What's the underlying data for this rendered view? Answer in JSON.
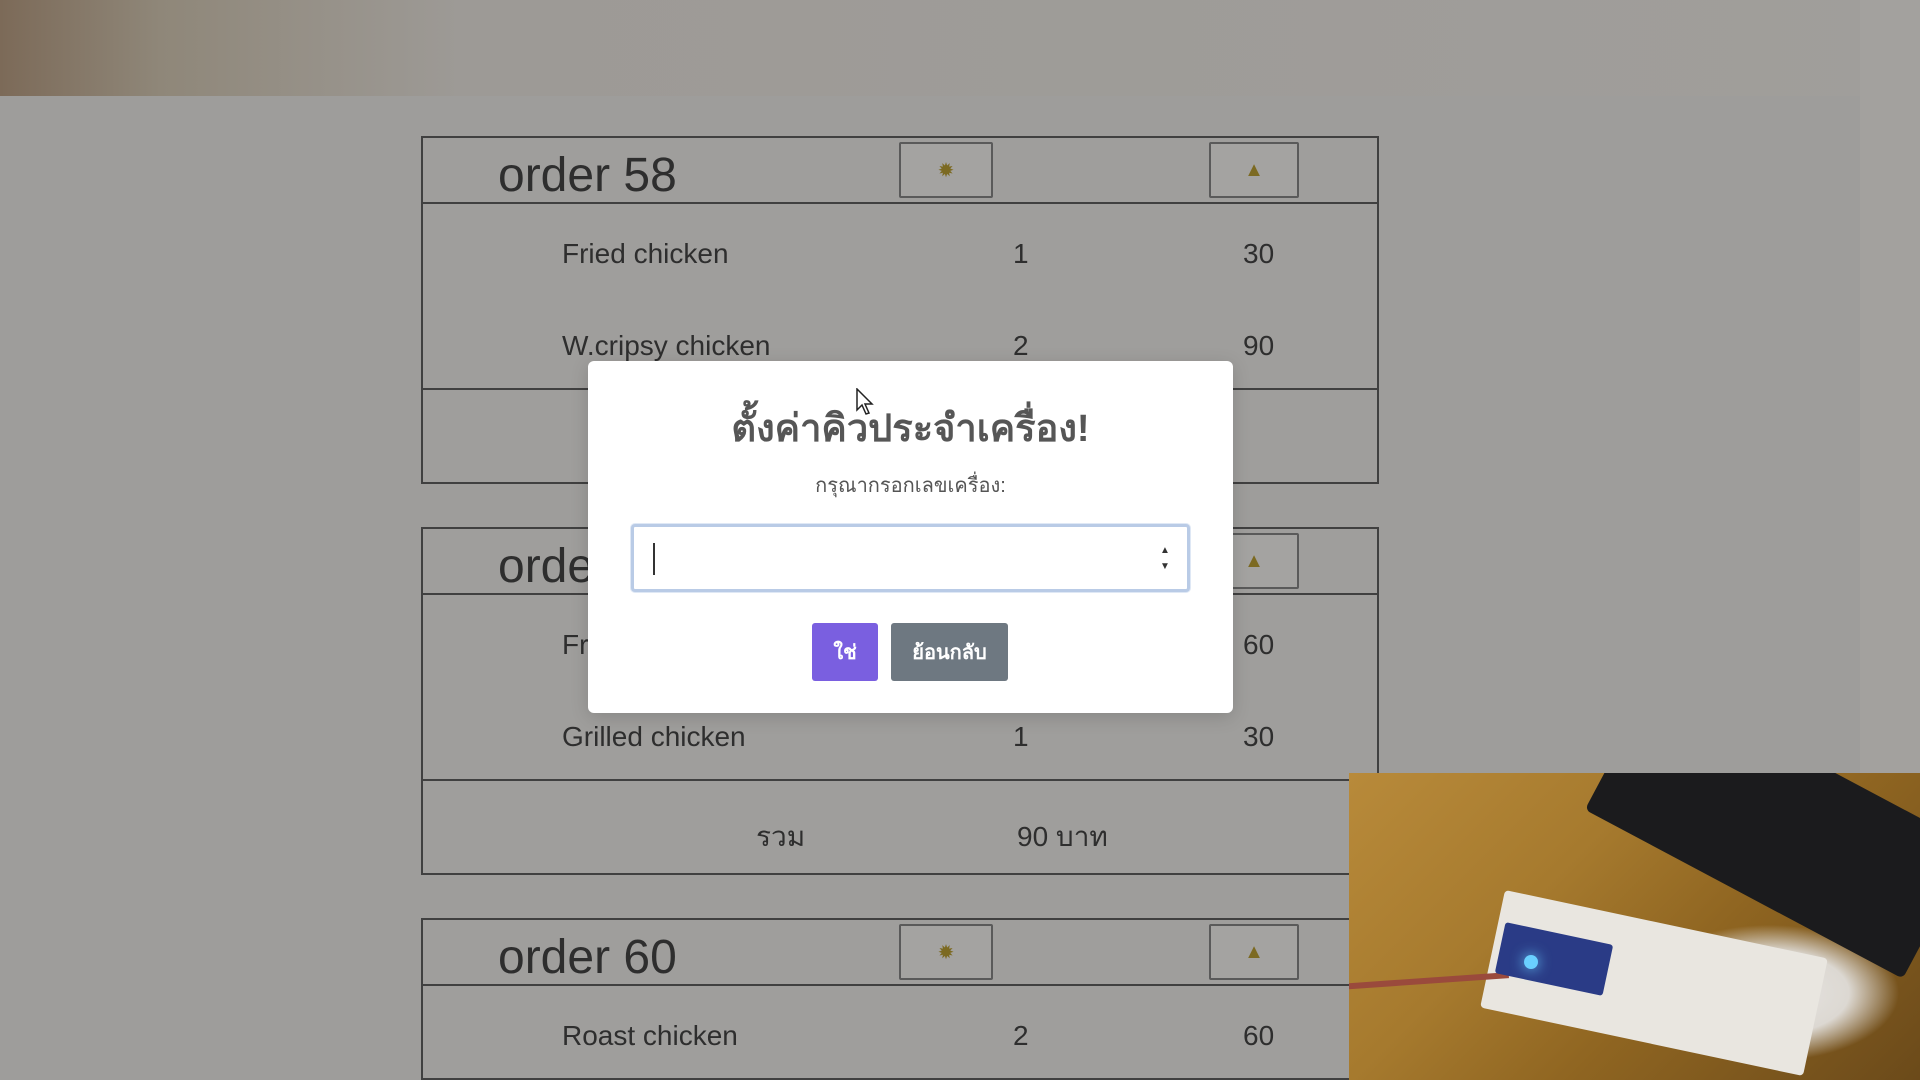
{
  "orders": [
    {
      "title": "order 58",
      "items": [
        {
          "name": "Fried chicken",
          "qty": "1",
          "price": "30"
        },
        {
          "name": "W.cripsy chicken",
          "qty": "2",
          "price": "90"
        }
      ]
    },
    {
      "title": "order",
      "items": [
        {
          "name": "Fri",
          "qty": "",
          "price": "60"
        },
        {
          "name": "Grilled chicken",
          "qty": "1",
          "price": "30"
        }
      ],
      "total_label": "รวม",
      "total_value": "90 บาท"
    },
    {
      "title": "order 60",
      "items": [
        {
          "name": "Roast chicken",
          "qty": "2",
          "price": "60"
        }
      ]
    }
  ],
  "modal": {
    "title": "ตั้งค่าคิวประจำเครื่อง!",
    "label": "กรุณากรอกเลขเครื่อง:",
    "input_value": "",
    "confirm_label": "ใช่",
    "back_label": "ย้อนกลับ"
  },
  "icons": {
    "settings": "gear-icon",
    "notify": "bell-icon"
  },
  "colors": {
    "confirm": "#7a5fe0",
    "back": "#6e7881",
    "input_border": "#b9cbe6"
  }
}
